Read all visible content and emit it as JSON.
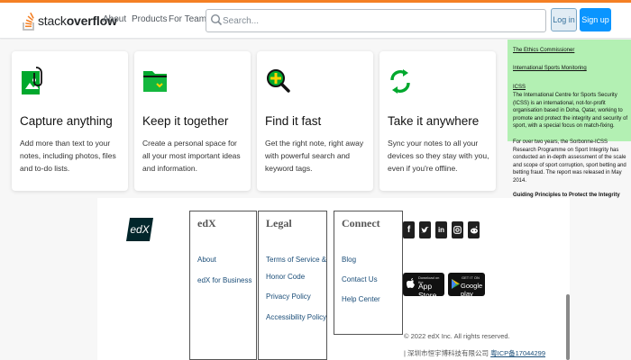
{
  "header": {
    "logo_text_light": "stack",
    "logo_text_bold": "overflow",
    "nav": [
      "About",
      "Products",
      "For Teams"
    ],
    "search_placeholder": "Search...",
    "login_label": "Log in",
    "signup_label": "Sign up",
    "accent_color": "#f48024",
    "signup_color": "#0a95ff"
  },
  "cards": [
    {
      "icon": "clip-icon",
      "title": "Capture anything",
      "text": "Add more than text to your notes, including photos, files and to-do lists."
    },
    {
      "icon": "folder-icon",
      "title": "Keep it together",
      "text": "Create a personal space for all your most important ideas and information."
    },
    {
      "icon": "search-plus-icon",
      "title": "Find it fast",
      "text": "Get the right note, right away with powerful search and keyword tags."
    },
    {
      "icon": "sync-icon",
      "title": "Take it anywhere",
      "text": "Sync your notes to all your devices so they stay with you, even if you're offline."
    }
  ],
  "ethics": {
    "link1": "The Ethics Commissioner",
    "link2": "International Sports Monitoring",
    "heading": "ICSS",
    "body": "The International Centre for Sports Security (ICSS) is an international, not-for-profit organisation based in Doha, Qatar, working to promote and protect the integrity and security of sport, with a special focus on match-fixing.",
    "body2": "For over two years, the Sorbonne-ICSS Research Programme on Sport Integrity has conducted an in-depth assessment of the scale and scope of sport corruption, sport betting and betting fraud. The report was released in May 2014.",
    "link3": "Guiding Principles to Protect the Integrity",
    "panel_color": "#b3f0b3"
  },
  "footer": {
    "logo": "edX",
    "columns": [
      {
        "heading": "edX",
        "links": [
          "About",
          "edX for Business"
        ]
      },
      {
        "heading": "Legal",
        "links": [
          "Terms of Service &",
          "Honor Code",
          "Privacy Policy",
          "Accessibility Policy"
        ]
      },
      {
        "heading": "Connect",
        "links": [
          "Blog",
          "Contact Us",
          "Help Center"
        ]
      }
    ],
    "social": [
      "facebook-icon",
      "twitter-icon",
      "linkedin-icon",
      "instagram-icon",
      "reddit-icon"
    ],
    "appstore_small": "Download on the",
    "appstore_big": "App Store",
    "googleplay_small": "GET IT ON",
    "googleplay_big": "Google play",
    "copyright": "© 2022 edX Inc. All rights reserved.",
    "icp_prefix": "| 深圳市恒宇博科技有限公司 ",
    "icp_link": "粤ICP备17044299"
  }
}
